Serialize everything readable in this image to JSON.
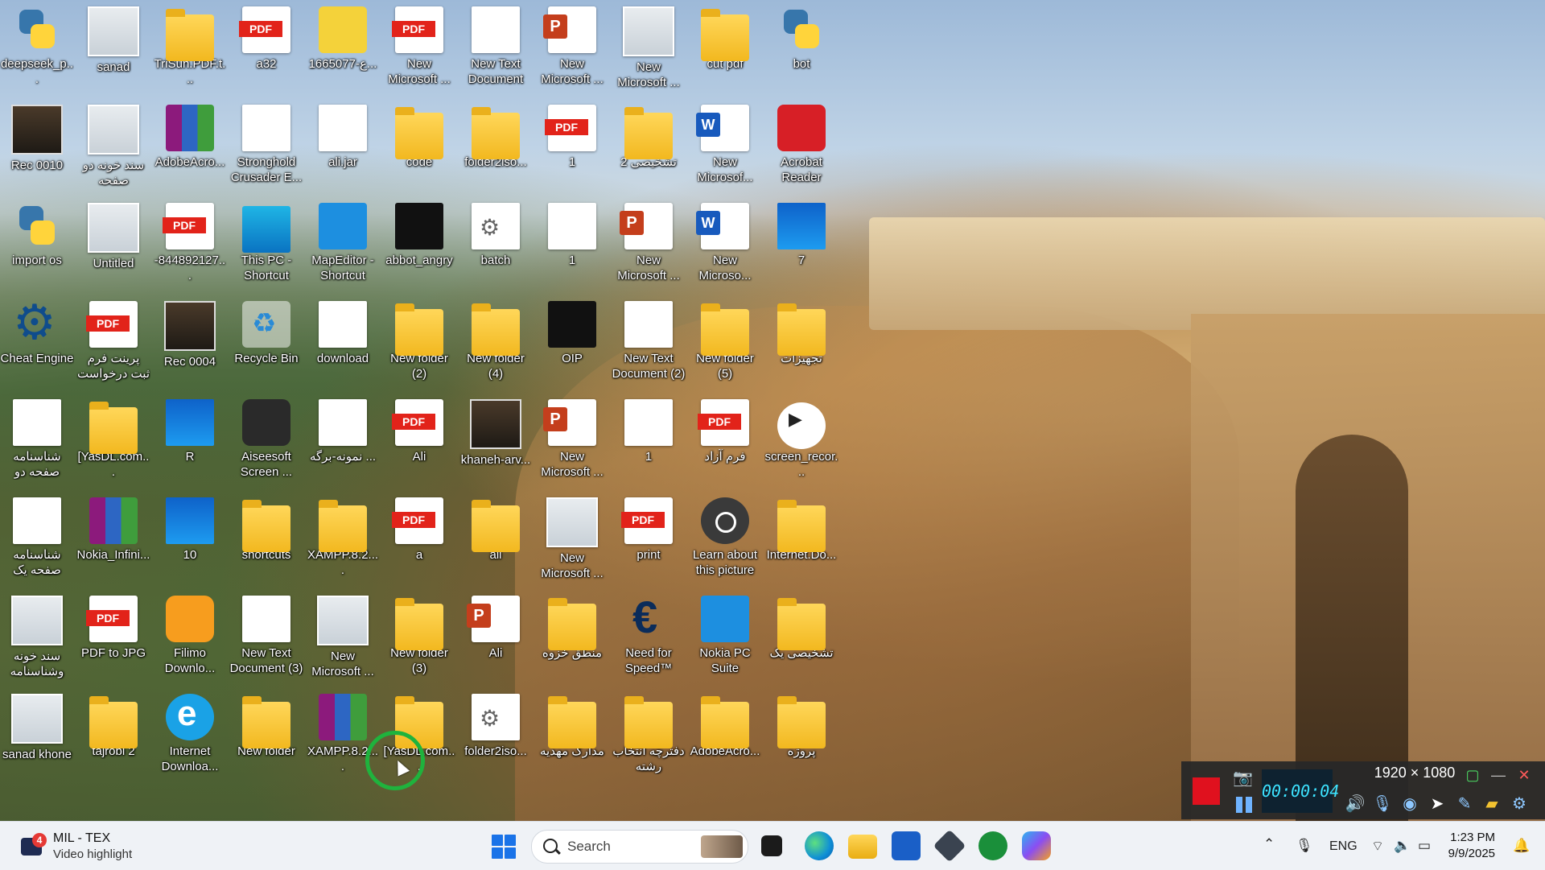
{
  "desktop": {
    "icons": [
      {
        "label": "deepseek_p...",
        "icon": "python-file-icon",
        "glyph": "g-py",
        "col": 0,
        "row": 0
      },
      {
        "label": "sanad",
        "icon": "image-file-icon",
        "glyph": "g-img",
        "col": 1,
        "row": 0
      },
      {
        "label": "TriSun.PDF.t...",
        "icon": "folder-icon",
        "glyph": "g-folder",
        "col": 2,
        "row": 0
      },
      {
        "label": "a32",
        "icon": "pdf-file-icon",
        "glyph": "g-pdf",
        "col": 3,
        "row": 0
      },
      {
        "label": "1665077-ع...",
        "icon": "spongebob-image-icon",
        "glyph": "g-sponge",
        "col": 4,
        "row": 0
      },
      {
        "label": "New Microsoft ...",
        "icon": "pdf-file-icon",
        "glyph": "g-pdf",
        "col": 5,
        "row": 0
      },
      {
        "label": "New Text Document",
        "icon": "text-file-icon",
        "glyph": "g-doc",
        "col": 6,
        "row": 0
      },
      {
        "label": "New Microsoft ...",
        "icon": "powerpoint-file-icon",
        "glyph": "g-ppt",
        "col": 7,
        "row": 0
      },
      {
        "label": "New Microsoft ...",
        "icon": "image-file-icon",
        "glyph": "g-img",
        "col": 8,
        "row": 0
      },
      {
        "label": "cut pdf",
        "icon": "folder-icon",
        "glyph": "g-folder",
        "col": 9,
        "row": 0
      },
      {
        "label": "bot",
        "icon": "python-file-icon",
        "glyph": "g-py",
        "col": 10,
        "row": 0
      },
      {
        "label": "Rec 0010",
        "icon": "video-file-icon",
        "glyph": "g-video",
        "col": 0,
        "row": 1
      },
      {
        "label": "سند خونه دو صفحه",
        "icon": "image-file-icon",
        "glyph": "g-img",
        "col": 1,
        "row": 1
      },
      {
        "label": "AdobeAcro...",
        "icon": "winrar-archive-icon",
        "glyph": "g-rar",
        "col": 2,
        "row": 1
      },
      {
        "label": "Stronghold Crusader E...",
        "icon": "shortcut-file-icon",
        "glyph": "g-doc",
        "col": 3,
        "row": 1
      },
      {
        "label": "ali.jar",
        "icon": "text-file-icon",
        "glyph": "g-doc",
        "col": 4,
        "row": 1
      },
      {
        "label": "code",
        "icon": "folder-icon",
        "glyph": "g-folder",
        "col": 5,
        "row": 1
      },
      {
        "label": "folder2iso...",
        "icon": "disc-folder-icon",
        "glyph": "g-folder",
        "col": 6,
        "row": 1
      },
      {
        "label": "1",
        "icon": "pdf-file-icon",
        "glyph": "g-pdf",
        "col": 7,
        "row": 1
      },
      {
        "label": "تشخیصی 2",
        "icon": "folder-icon",
        "glyph": "g-folder",
        "col": 8,
        "row": 1
      },
      {
        "label": "New Microsof...",
        "icon": "word-file-icon",
        "glyph": "g-word",
        "col": 9,
        "row": 1
      },
      {
        "label": "Acrobat Reader",
        "icon": "acrobat-reader-icon",
        "glyph": "g-red",
        "col": 10,
        "row": 1
      },
      {
        "label": "import os",
        "icon": "python-file-icon",
        "glyph": "g-py",
        "col": 0,
        "row": 2
      },
      {
        "label": "Untitled",
        "icon": "image-file-icon",
        "glyph": "g-img",
        "col": 1,
        "row": 2
      },
      {
        "label": "-844892127...",
        "icon": "pdf-file-icon",
        "glyph": "g-pdf",
        "col": 2,
        "row": 2
      },
      {
        "label": "This PC - Shortcut",
        "icon": "monitor-icon",
        "glyph": "g-monitor",
        "col": 3,
        "row": 2
      },
      {
        "label": "MapEditor - Shortcut",
        "icon": "map-editor-icon",
        "glyph": "g-blue",
        "col": 4,
        "row": 2
      },
      {
        "label": "abbot_angry",
        "icon": "image-file-icon",
        "glyph": "g-dark",
        "col": 5,
        "row": 2
      },
      {
        "label": "batch",
        "icon": "batch-file-icon",
        "glyph": "g-gear",
        "col": 6,
        "row": 2
      },
      {
        "label": "1",
        "icon": "text-file-icon",
        "glyph": "g-doc",
        "col": 7,
        "row": 2
      },
      {
        "label": "New Microsoft ...",
        "icon": "powerpoint-file-icon",
        "glyph": "g-ppt",
        "col": 8,
        "row": 2
      },
      {
        "label": "New Microso...",
        "icon": "word-file-icon",
        "glyph": "g-word",
        "col": 9,
        "row": 2
      },
      {
        "label": "7",
        "icon": "windows7-image-icon",
        "glyph": "g-win10",
        "col": 10,
        "row": 2
      },
      {
        "label": "Cheat Engine",
        "icon": "cheat-engine-icon",
        "glyph": "g-gearblue",
        "col": 0,
        "row": 3
      },
      {
        "label": "پرینت فرم ثبت درخواست د...",
        "icon": "pdf-file-icon",
        "glyph": "g-pdf",
        "col": 1,
        "row": 3
      },
      {
        "label": "Rec 0004",
        "icon": "video-file-icon",
        "glyph": "g-video",
        "col": 2,
        "row": 3
      },
      {
        "label": "Recycle Bin",
        "icon": "recycle-bin-icon",
        "glyph": "g-recycle",
        "col": 3,
        "row": 3
      },
      {
        "label": "download",
        "icon": "document-file-icon",
        "glyph": "g-doc",
        "col": 4,
        "row": 3
      },
      {
        "label": "New folder (2)",
        "icon": "folder-icon",
        "glyph": "g-folder",
        "col": 5,
        "row": 3
      },
      {
        "label": "New folder (4)",
        "icon": "folder-icon",
        "glyph": "g-folder",
        "col": 6,
        "row": 3
      },
      {
        "label": "OIP",
        "icon": "image-file-icon",
        "glyph": "g-dark",
        "col": 7,
        "row": 3
      },
      {
        "label": "New Text Document (2)",
        "icon": "text-file-icon",
        "glyph": "g-doc",
        "col": 8,
        "row": 3
      },
      {
        "label": "New folder (5)",
        "icon": "folder-icon",
        "glyph": "g-folder",
        "col": 9,
        "row": 3
      },
      {
        "label": "تجهیزات",
        "icon": "folder-icon",
        "glyph": "g-folder",
        "col": 10,
        "row": 3
      },
      {
        "label": "شناسنامه صفحه دو",
        "icon": "document-file-icon",
        "glyph": "g-doc",
        "col": 0,
        "row": 4
      },
      {
        "label": "[YasDL.com...",
        "icon": "folder-icon",
        "glyph": "g-folder",
        "col": 1,
        "row": 4
      },
      {
        "label": "R",
        "icon": "windows-image-icon",
        "glyph": "g-win10",
        "col": 2,
        "row": 4
      },
      {
        "label": "Aiseesoft Screen ...",
        "icon": "aiseesoft-icon",
        "glyph": "g-app",
        "col": 3,
        "row": 4
      },
      {
        "label": "نمونه-برگه ...",
        "icon": "document-file-icon",
        "glyph": "g-doc",
        "col": 4,
        "row": 4
      },
      {
        "label": "Ali",
        "icon": "pdf-file-icon",
        "glyph": "g-pdf",
        "col": 5,
        "row": 4
      },
      {
        "label": "khaneh-arv...",
        "icon": "video-file-icon",
        "glyph": "g-video",
        "col": 6,
        "row": 4
      },
      {
        "label": "New Microsoft ...",
        "icon": "powerpoint-file-icon",
        "glyph": "g-ppt",
        "col": 7,
        "row": 4
      },
      {
        "label": "1",
        "icon": "document-file-icon",
        "glyph": "g-doc",
        "col": 8,
        "row": 4
      },
      {
        "label": "فرم آزاد",
        "icon": "pdf-file-icon",
        "glyph": "g-pdf",
        "col": 9,
        "row": 4
      },
      {
        "label": "screen_recor...",
        "icon": "media-play-icon",
        "glyph": "g-play",
        "col": 10,
        "row": 4
      },
      {
        "label": "شناسنامه صفحه یک",
        "icon": "document-file-icon",
        "glyph": "g-doc",
        "col": 0,
        "row": 5
      },
      {
        "label": "Nokia_Infini...",
        "icon": "winrar-archive-icon",
        "glyph": "g-rar",
        "col": 1,
        "row": 5
      },
      {
        "label": "10",
        "icon": "windows10-image-icon",
        "glyph": "g-win10",
        "col": 2,
        "row": 5
      },
      {
        "label": "shortcuts",
        "icon": "folder-icon",
        "glyph": "g-folder",
        "col": 3,
        "row": 5
      },
      {
        "label": "XAMPP.8.2....",
        "icon": "folder-icon",
        "glyph": "g-folder",
        "col": 4,
        "row": 5
      },
      {
        "label": "a",
        "icon": "pdf-file-icon",
        "glyph": "g-pdf",
        "col": 5,
        "row": 5
      },
      {
        "label": "ali",
        "icon": "folder-icon",
        "glyph": "g-folder",
        "col": 6,
        "row": 5
      },
      {
        "label": "New Microsoft ...",
        "icon": "image-file-icon",
        "glyph": "g-img",
        "col": 7,
        "row": 5
      },
      {
        "label": "print",
        "icon": "pdf-file-icon",
        "glyph": "g-pdf",
        "col": 8,
        "row": 5
      },
      {
        "label": "Learn about this picture",
        "icon": "camera-lens-icon",
        "glyph": "g-lens",
        "col": 9,
        "row": 5
      },
      {
        "label": "Internet.Do...",
        "icon": "folder-icon",
        "glyph": "g-folder",
        "col": 10,
        "row": 5
      },
      {
        "label": "سند خونه وشناسنامه",
        "icon": "image-file-icon",
        "glyph": "g-img",
        "col": 0,
        "row": 6
      },
      {
        "label": "PDF to JPG",
        "icon": "pdf-to-jpg-icon",
        "glyph": "g-pdf",
        "col": 1,
        "row": 6
      },
      {
        "label": "Filimo Downlo...",
        "icon": "filimo-icon",
        "glyph": "g-orange",
        "col": 2,
        "row": 6
      },
      {
        "label": "New Text Document (3)",
        "icon": "text-file-icon",
        "glyph": "g-doc",
        "col": 3,
        "row": 6
      },
      {
        "label": "New Microsoft ...",
        "icon": "image-file-icon",
        "glyph": "g-img",
        "col": 4,
        "row": 6
      },
      {
        "label": "New folder (3)",
        "icon": "folder-icon",
        "glyph": "g-folder",
        "col": 5,
        "row": 6
      },
      {
        "label": "Ali",
        "icon": "powerpoint-file-icon",
        "glyph": "g-ppt",
        "col": 6,
        "row": 6
      },
      {
        "label": "منطق خزوه",
        "icon": "folder-icon",
        "glyph": "g-folder",
        "col": 7,
        "row": 6
      },
      {
        "label": "Need for Speed™ Mo...",
        "icon": "nfs-game-icon",
        "glyph": "g-nfs",
        "col": 8,
        "row": 6
      },
      {
        "label": "Nokia PC Suite",
        "icon": "nokia-pc-suite-icon",
        "glyph": "g-blue",
        "col": 9,
        "row": 6
      },
      {
        "label": "تشخیصی یک",
        "icon": "folder-icon",
        "glyph": "g-folder",
        "col": 10,
        "row": 6
      },
      {
        "label": "sanad khone",
        "icon": "image-file-icon",
        "glyph": "g-img",
        "col": 0,
        "row": 7
      },
      {
        "label": "tajrobi 2",
        "icon": "folder-icon",
        "glyph": "g-folder",
        "col": 1,
        "row": 7
      },
      {
        "label": "Internet Downloa...",
        "icon": "internet-download-manager-icon",
        "glyph": "g-ie",
        "col": 2,
        "row": 7
      },
      {
        "label": "New folder",
        "icon": "folder-icon",
        "glyph": "g-folder",
        "col": 3,
        "row": 7
      },
      {
        "label": "XAMPP.8.2....",
        "icon": "winrar-archive-icon",
        "glyph": "g-rar",
        "col": 4,
        "row": 7
      },
      {
        "label": "[YasDL.com...",
        "icon": "folder-icon",
        "glyph": "g-folder",
        "col": 5,
        "row": 7
      },
      {
        "label": "folder2iso...",
        "icon": "settings-file-icon",
        "glyph": "g-gear",
        "col": 6,
        "row": 7
      },
      {
        "label": "مدارک مهدیه",
        "icon": "folder-icon",
        "glyph": "g-folder",
        "col": 7,
        "row": 7
      },
      {
        "label": "دفترچه انتخاب رشته",
        "icon": "folder-icon",
        "glyph": "g-folder",
        "col": 8,
        "row": 7
      },
      {
        "label": "AdobeAcro...",
        "icon": "folder-icon",
        "glyph": "g-folder",
        "col": 9,
        "row": 7
      },
      {
        "label": "پروژه",
        "icon": "folder-icon",
        "glyph": "g-folder",
        "col": 10,
        "row": 7
      }
    ]
  },
  "taskbar": {
    "news_title": "MIL - TEX",
    "news_subtitle": "Video highlight",
    "news_badge": "4",
    "search_placeholder": "Search",
    "apps": [
      "task-view-icon",
      "edge-browser-icon",
      "file-explorer-icon",
      "microsoft-store-icon",
      "app-cube-icon",
      "xbox-icon",
      "copilot-icon"
    ],
    "tray": {
      "language": "ENG",
      "time": "1:23 PM",
      "date": "9/9/2025"
    }
  },
  "recorder": {
    "timer": "00:00:04",
    "resolution": "1920 × 1080"
  }
}
